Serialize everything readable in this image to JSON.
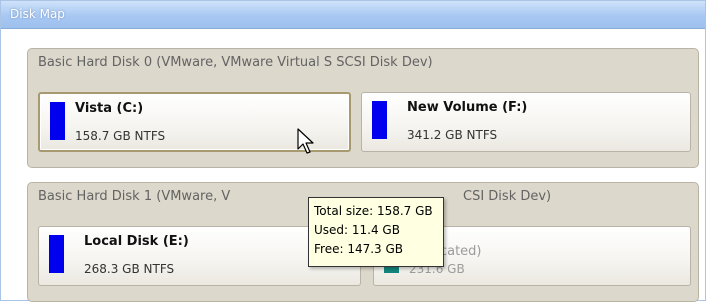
{
  "panel": {
    "title": "Disk Map"
  },
  "disks": [
    {
      "title": "Basic Hard Disk 0 (VMware, VMware Virtual S SCSI Disk Dev)",
      "volumes": [
        {
          "name": "Vista (C:)",
          "info": "158.7 GB NTFS",
          "color": "#0000ee",
          "selected": true
        },
        {
          "name": "New Volume (F:)",
          "info": "341.2 GB NTFS",
          "color": "#0000ee"
        }
      ]
    },
    {
      "title": "Basic Hard Disk 1 (VMware, V",
      "title_tail": "CSI Disk Dev)",
      "volumes": [
        {
          "name": "Local Disk (E:)",
          "info": "268.3 GB NTFS",
          "color": "#0000ee"
        },
        {
          "name": "ocated)",
          "info": "231.6 GB",
          "color": "#13867c"
        }
      ]
    }
  ],
  "tooltip": {
    "total": "Total size: 158.7 GB",
    "used": "Used: 11.4 GB",
    "free": "Free: 147.3 GB"
  }
}
